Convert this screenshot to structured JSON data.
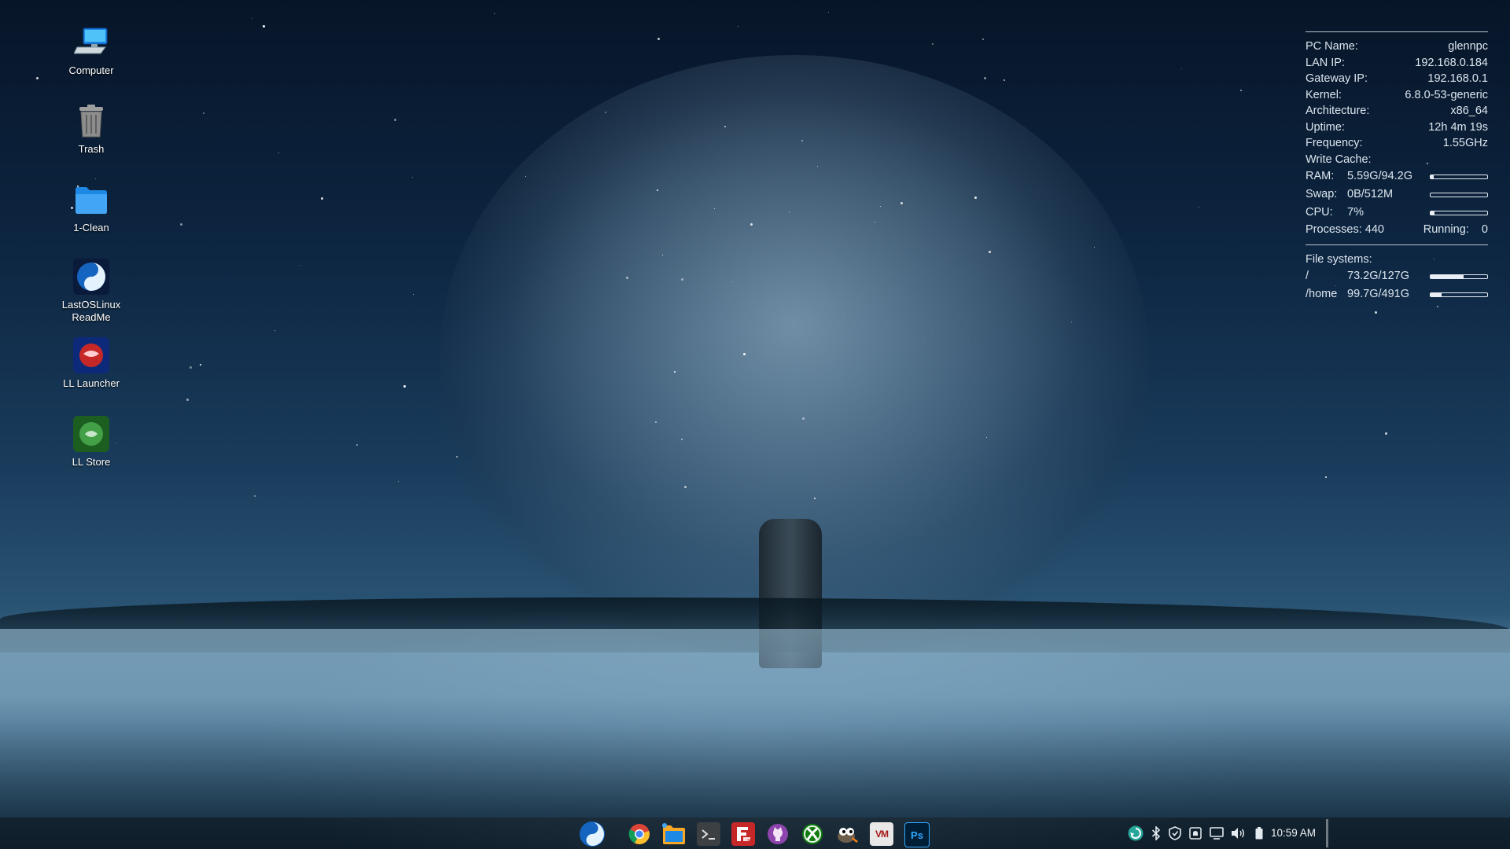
{
  "desktop_icons": [
    {
      "label": "Computer",
      "icon": "computer-icon"
    },
    {
      "label": "Trash",
      "icon": "trash-icon"
    },
    {
      "label": "1-Clean",
      "icon": "folder-icon"
    },
    {
      "label": "LastOSLinux ReadMe",
      "label_line1": "LastOSLinux",
      "label_line2": "ReadMe",
      "icon": "lastos-readme-icon"
    },
    {
      "label": "LL Launcher",
      "icon": "ll-launcher-icon"
    },
    {
      "label": "LL Store",
      "icon": "ll-store-icon"
    }
  ],
  "conky": {
    "pc_name": {
      "label": "PC Name:",
      "value": "glennpc"
    },
    "lan_ip": {
      "label": "LAN IP:",
      "value": "192.168.0.184"
    },
    "gateway_ip": {
      "label": "Gateway IP:",
      "value": "192.168.0.1"
    },
    "kernel": {
      "label": "Kernel:",
      "value": "6.8.0-53-generic"
    },
    "architecture": {
      "label": "Architecture:",
      "value": "x86_64"
    },
    "uptime": {
      "label": "Uptime:",
      "value": "12h 4m 19s"
    },
    "frequency": {
      "label": "Frequency:",
      "value": "1.55GHz"
    },
    "write_cache": {
      "label": "Write Cache:"
    },
    "ram": {
      "label": "RAM:",
      "value": "5.59G/94.2G",
      "fraction": 0.06
    },
    "swap": {
      "label": "Swap:",
      "value": "0B/512M",
      "fraction": 0.0
    },
    "cpu": {
      "label": "CPU:",
      "value": "7%",
      "fraction": 0.07
    },
    "processes": {
      "label": "Processes:",
      "value": "440",
      "running_label": "Running:",
      "running_value": "0"
    },
    "file_systems": {
      "label": "File systems:",
      "items": [
        {
          "mount": "/",
          "value": "73.2G/127G",
          "fraction": 0.58
        },
        {
          "mount": "/home",
          "value": "99.7G/491G",
          "fraction": 0.2
        }
      ]
    }
  },
  "taskbar": {
    "apps": [
      {
        "name": "start-menu",
        "icon": "lastos-menu-icon"
      },
      {
        "name": "chrome",
        "icon": "chrome-icon"
      },
      {
        "name": "file-manager",
        "icon": "file-manager-icon"
      },
      {
        "name": "terminal",
        "icon": "terminal-icon"
      },
      {
        "name": "filezilla",
        "icon": "filezilla-icon"
      },
      {
        "name": "github",
        "icon": "github-icon"
      },
      {
        "name": "xbox",
        "icon": "xbox-icon"
      },
      {
        "name": "gimp",
        "icon": "gimp-icon"
      },
      {
        "name": "vmware",
        "icon": "vmware-icon",
        "text": "VM"
      },
      {
        "name": "photoshop",
        "icon": "photoshop-icon",
        "text": "Ps"
      }
    ],
    "tray": [
      "update-icon",
      "bluetooth-icon",
      "shield-icon",
      "notification-icon",
      "display-icon",
      "volume-icon",
      "battery-icon"
    ],
    "clock": "10:59 AM"
  },
  "colors": {
    "accent": "#1e88e5",
    "conky_text": "#dde6ee",
    "taskbar_bg": "#0a121a"
  }
}
